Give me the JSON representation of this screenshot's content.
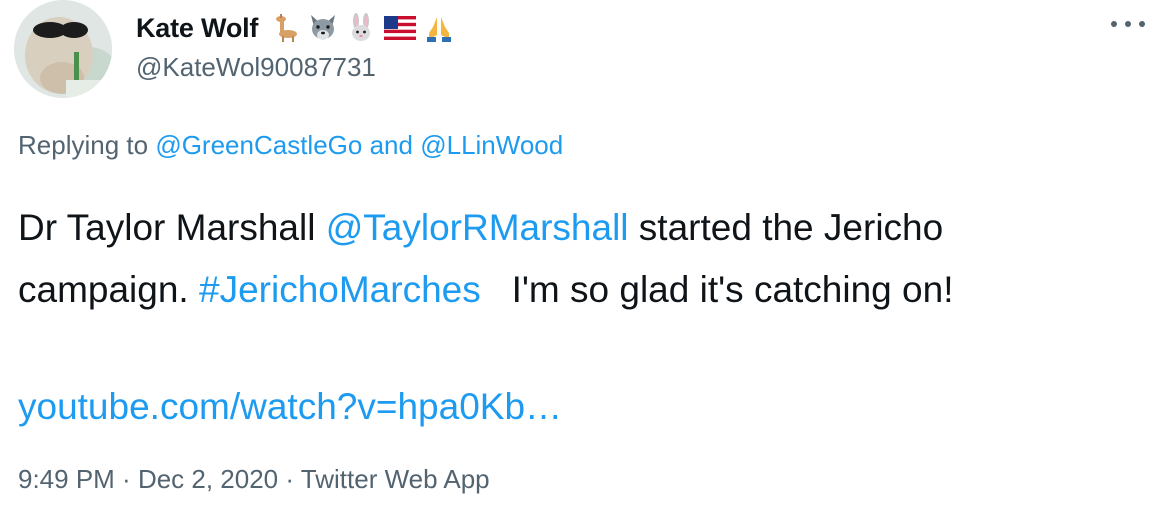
{
  "author": {
    "display_name": "Kate Wolf",
    "handle": "@KateWol90087731",
    "name_emoji_icons": [
      "llama-icon",
      "wolf-face-icon",
      "rabbit-face-icon",
      "us-flag-icon",
      "folded-hands-icon"
    ]
  },
  "menu": {
    "icon": "more-options-icon"
  },
  "reply_context": {
    "prefix": "Replying to",
    "users": [
      "@GreenCastleGo",
      "@LLinWood"
    ],
    "conjunction": "and"
  },
  "tweet": {
    "line1": {
      "text_before": "Dr Taylor Marshall ",
      "mention": "@TaylorRMarshall",
      "text_after": " started the Jericho"
    },
    "line2": {
      "text_before": "campaign. ",
      "hashtag": "#JerichoMarches",
      "text_after": "   I'm so glad it's catching on!"
    },
    "link": "youtube.com/watch?v=hpa0Kb…"
  },
  "meta": {
    "time": "9:49 PM",
    "date": "Dec 2, 2020",
    "source": "Twitter Web App",
    "separator": " · "
  },
  "colors": {
    "link": "#1d9bf0",
    "text": "#0f1419",
    "secondary": "#536471",
    "background": "#ffffff"
  }
}
